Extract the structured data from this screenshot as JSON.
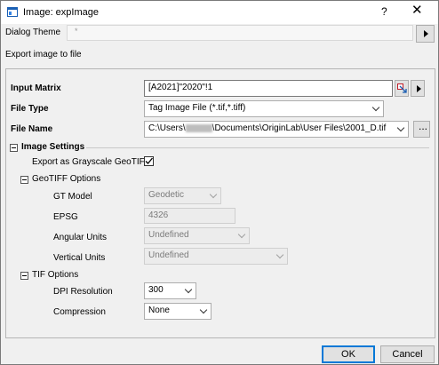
{
  "window": {
    "title": "Image: expImage",
    "help_label": "?",
    "close_label": "✕"
  },
  "dialog_theme": {
    "label": "Dialog Theme",
    "value": "*"
  },
  "section_title": "Export image to file",
  "input_matrix": {
    "label": "Input Matrix",
    "value": "[A2021]\"2020\"!1"
  },
  "file_type": {
    "label": "File Type",
    "value": "Tag Image File (*.tif,*.tiff)"
  },
  "file_name": {
    "label": "File Name",
    "value_start": "C:\\Users\\",
    "value_end": "\\Documents\\OriginLab\\User Files\\2001_D.tif",
    "browse_label": "..."
  },
  "image_settings": {
    "label": "Image Settings",
    "grayscale": {
      "label": "Export as Grayscale GeoTIFF",
      "checked": true
    },
    "geotiff": {
      "label": "GeoTIFF Options",
      "gt_model": {
        "label": "GT Model",
        "value": "Geodetic"
      },
      "epsg": {
        "label": "EPSG",
        "value": "4326"
      },
      "angular_units": {
        "label": "Angular Units",
        "value": "Undefined"
      },
      "vertical_units": {
        "label": "Vertical Units",
        "value": "Undefined"
      }
    },
    "tif": {
      "label": "TIF Options",
      "dpi": {
        "label": "DPI Resolution",
        "value": "300"
      },
      "compression": {
        "label": "Compression",
        "value": "None"
      }
    }
  },
  "footer": {
    "ok_label": "OK",
    "cancel_label": "Cancel"
  }
}
